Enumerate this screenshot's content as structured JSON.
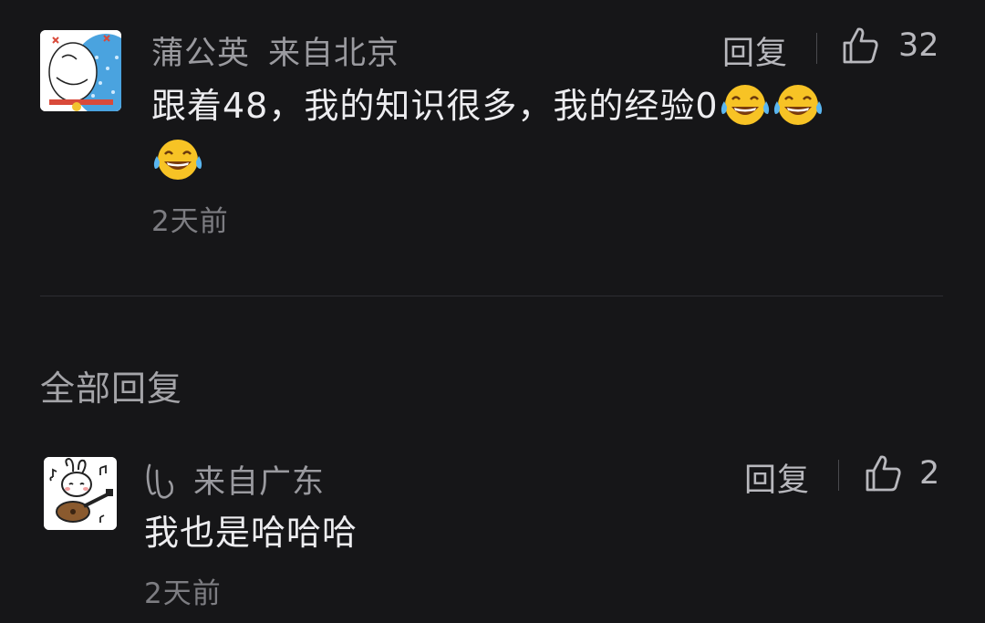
{
  "main_comment": {
    "username": "蒲公英",
    "location": "来自北京",
    "reply_label": "回复",
    "like_count": "32",
    "text": "跟着48，我的知识很多，我的经验0",
    "emojis": [
      "laughing-tears-emoji",
      "laughing-tears-emoji",
      "laughing-tears-emoji"
    ],
    "time": "2天前",
    "avatar": "doraemon-avatar"
  },
  "section": {
    "title": "全部回复"
  },
  "reply_comment": {
    "username_icon": "handwritten-glyph-icon",
    "location": "来自广东",
    "reply_label": "回复",
    "like_count": "2",
    "text": "我也是哈哈哈",
    "time": "2天前",
    "avatar": "rabbit-guitar-avatar"
  },
  "colors": {
    "background": "#161618",
    "primary_text": "#ededf0",
    "secondary_text": "#9a9a9f",
    "emoji_yellow": "#f7c325"
  }
}
